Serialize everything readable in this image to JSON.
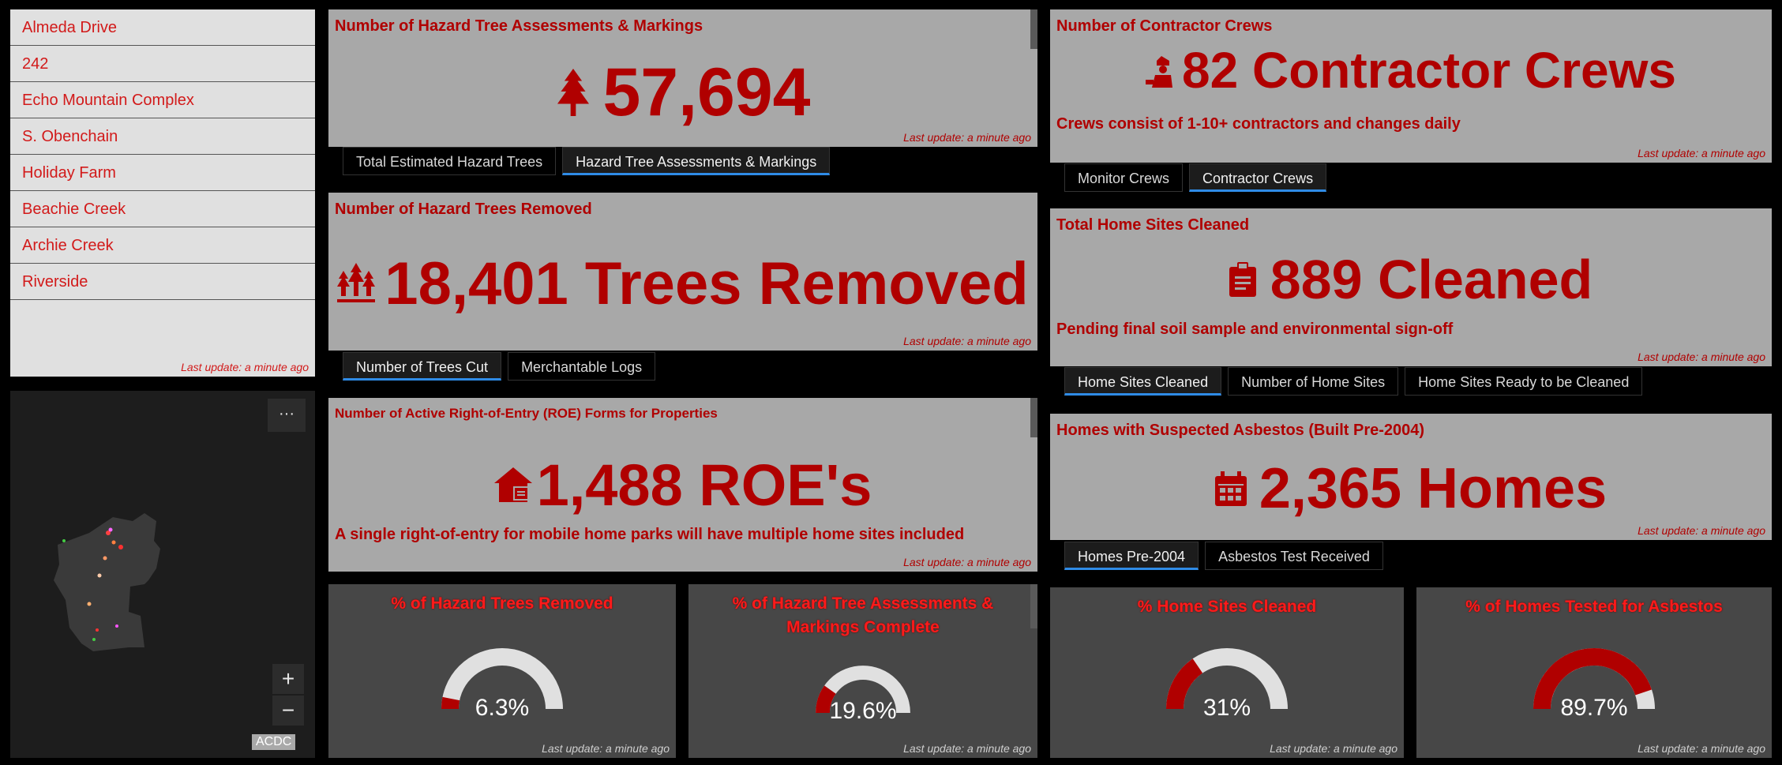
{
  "update_text": "Last update: a minute ago",
  "colors": {
    "accent_red": "#b00000",
    "tab_underline": "#2f8be6",
    "gauge_track": "#e0e0e0"
  },
  "incident_list": {
    "items": [
      "Almeda Drive",
      "242",
      "Echo Mountain Complex",
      "S. Obenchain",
      "Holiday Farm",
      "Beachie Creek",
      "Archie Creek",
      "Riverside"
    ]
  },
  "map": {
    "more_label": "···",
    "zoom_in": "+",
    "zoom_out": "−",
    "attribution": "ACDC"
  },
  "assessments": {
    "title": "Number of Hazard Tree Assessments & Markings",
    "icon": "tree-icon",
    "value": "57,694",
    "tabs": [
      "Total Estimated Hazard Trees",
      "Hazard Tree Assessments & Markings"
    ],
    "active_tab": 1
  },
  "removed": {
    "title": "Number of Hazard Trees Removed",
    "icon": "trees-cut-icon",
    "value": "18,401 Trees Removed",
    "tabs": [
      "Number of Trees Cut",
      "Merchantable Logs"
    ],
    "active_tab": 0
  },
  "roe": {
    "title": "Number of Active Right-of-Entry (ROE) Forms for Properties",
    "icon": "home-form-icon",
    "value": "1,488 ROE's",
    "note": "A single right-of-entry for mobile home parks will have multiple home sites included"
  },
  "crews": {
    "title": "Number of Contractor Crews",
    "icon": "worker-icon",
    "value": "82 Contractor Crews",
    "note": "Crews consist of 1-10+ contractors and changes daily",
    "tabs": [
      "Monitor Crews",
      "Contractor Crews"
    ],
    "active_tab": 1
  },
  "homesites": {
    "title": "Total Home Sites Cleaned",
    "icon": "clipboard-icon",
    "value": "889 Cleaned",
    "note": "Pending final soil sample and environmental sign-off",
    "tabs": [
      "Home Sites Cleaned",
      "Number of Home Sites",
      "Home Sites Ready to be Cleaned"
    ],
    "active_tab": 0
  },
  "asbestos": {
    "title": "Homes with Suspected Asbestos (Built Pre-2004)",
    "icon": "calendar-icon",
    "value": "2,365 Homes",
    "tabs": [
      "Homes Pre-2004",
      "Asbestos Test Received"
    ],
    "active_tab": 0
  },
  "gauges": [
    {
      "title": "% of Hazard Trees Removed",
      "label": "6.3%",
      "fraction": 0.063
    },
    {
      "title": "% of Hazard Tree Assessments & Markings Complete",
      "label": "19.6%",
      "fraction": 0.196
    },
    {
      "title": "% Home Sites Cleaned",
      "label": "31%",
      "fraction": 0.31
    },
    {
      "title": "% of Homes Tested for Asbestos",
      "label": "89.7%",
      "fraction": 0.897
    }
  ]
}
